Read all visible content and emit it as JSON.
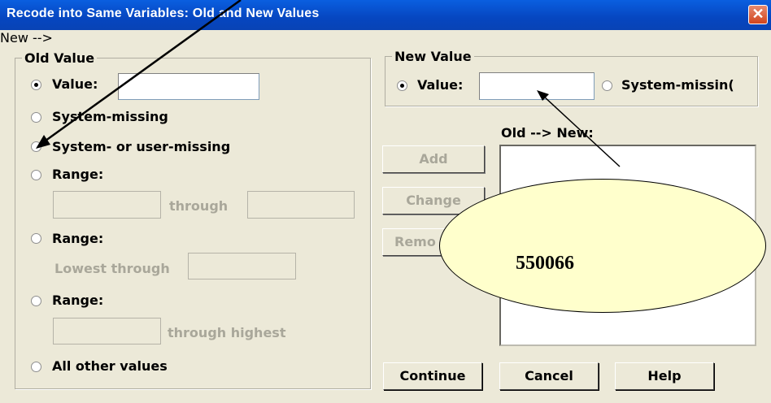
{
  "window": {
    "title": "Recode into Same Variables: Old and New Values",
    "close_glyph": "✕"
  },
  "old_value": {
    "legend": "Old Value",
    "value_label": "Value:",
    "value_input": "",
    "system_missing_label": "System-missing",
    "system_or_user_missing_label": "System- or user-missing",
    "range1_label": "Range:",
    "range1_through": "through",
    "range2_label": "Range:",
    "range2_lowest_through": "Lowest through",
    "range3_label": "Range:",
    "range3_through_highest": "through highest",
    "all_other_values_label": "All other values",
    "selected": "Value"
  },
  "new_value": {
    "legend": "New Value",
    "value_label": "Value:",
    "value_input": "",
    "system_missing_label": "System-missin(",
    "selected": "Value"
  },
  "mapping": {
    "label": "Old --> New:",
    "items": []
  },
  "buttons": {
    "add": "Add",
    "change": "Change",
    "remove": "Remo",
    "continue": "Continue",
    "cancel": "Cancel",
    "help": "Help"
  },
  "callout": {
    "text": "550066",
    "fill": "#FFFFCC"
  },
  "colors": {
    "titlebar": "#0A5FE0",
    "dialog": "#ECE9D8",
    "disabled_text": "#A9A79A"
  }
}
